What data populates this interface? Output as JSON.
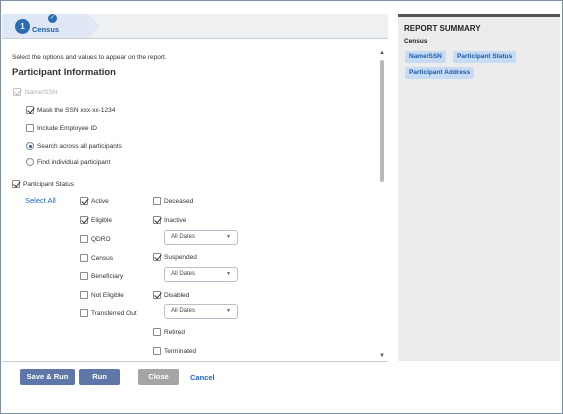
{
  "stepper": {
    "current_step": "Census",
    "step_number": "1"
  },
  "main": {
    "instruction": "Select the options and values to appear on the report.",
    "section_title": "Participant Information",
    "name_ssn": "Name/SSN",
    "mask_ssn": "Mask the SSN xxx-xx-1234",
    "include_employee_id": "Include Employee ID",
    "search_all": "Search across all participants",
    "find_individual": "Find individual participant",
    "participant_status": "Participant Status",
    "select_all": "Select All",
    "statuses_left": [
      {
        "label": "Active",
        "checked": true
      },
      {
        "label": "Eligible",
        "checked": true
      },
      {
        "label": "QDRO",
        "checked": false
      },
      {
        "label": "Census",
        "checked": false
      },
      {
        "label": "Beneficiary",
        "checked": false
      },
      {
        "label": "Not Eligible",
        "checked": false
      },
      {
        "label": "Transferred Out",
        "checked": false
      }
    ],
    "statuses_right": [
      {
        "label": "Deceased",
        "checked": false
      },
      {
        "label": "Inactive",
        "checked": true
      },
      {
        "label": "Suspended",
        "checked": true
      },
      {
        "label": "Disabled",
        "checked": true
      },
      {
        "label": "Retired",
        "checked": false
      },
      {
        "label": "Terminated",
        "checked": false
      }
    ],
    "date_dropdown_value": "All Dates"
  },
  "buttons": {
    "save_run": "Save & Run",
    "run": "Run",
    "close": "Close",
    "cancel": "Cancel"
  },
  "summary": {
    "title": "REPORT SUMMARY",
    "subtitle": "Census",
    "chips": [
      "Name/SSN",
      "Participant Status",
      "Participant Address"
    ]
  },
  "colors": {
    "accent": "#1f5aa6",
    "button_primary": "#5e77a8",
    "button_disabled": "#a5a5a5",
    "chip_bg": "#c6dbf5"
  }
}
